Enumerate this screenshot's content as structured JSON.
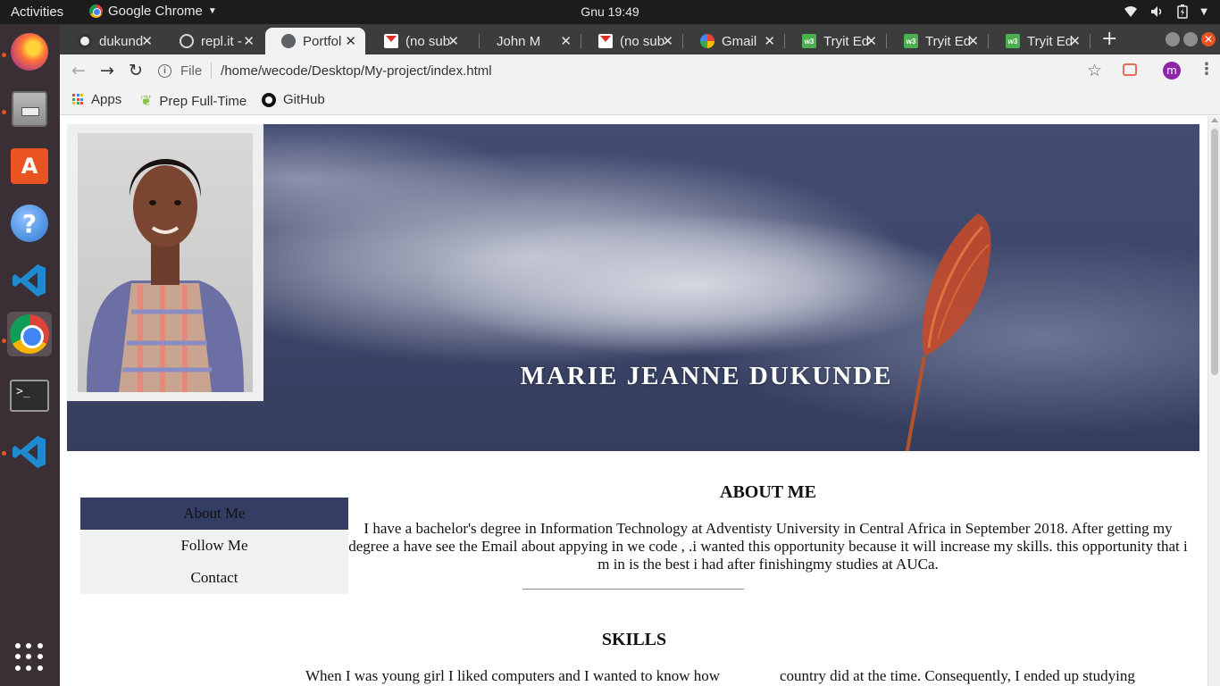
{
  "topbar": {
    "activities": "Activities",
    "app_name": "Google Chrome",
    "clock": "Gnu 19:49"
  },
  "dock": {
    "apps": [
      "firefox",
      "files",
      "ubuntu-software",
      "help",
      "vscode",
      "chrome",
      "terminal",
      "vscode"
    ]
  },
  "browser": {
    "tabs": [
      {
        "title": "dukund",
        "icon": "github-icon"
      },
      {
        "title": "repl.it -",
        "icon": "repl-icon"
      },
      {
        "title": "Portfol",
        "icon": "globe-icon",
        "active": true
      },
      {
        "title": "(no sub",
        "icon": "gmail-icon"
      },
      {
        "title": "John M",
        "icon": ""
      },
      {
        "title": "(no sub",
        "icon": "gmail-icon"
      },
      {
        "title": "Gmail",
        "icon": "google-icon"
      },
      {
        "title": "Tryit Ed",
        "icon": "w3schools-icon"
      },
      {
        "title": "Tryit Ed",
        "icon": "w3schools-icon"
      },
      {
        "title": "Tryit Ed",
        "icon": "w3schools-icon"
      }
    ],
    "address": {
      "scheme": "File",
      "url": "/home/wecode/Desktop/My-project/index.html"
    },
    "profile_initial": "m",
    "bookmarks": [
      "Apps",
      "Prep Full-Time",
      "GitHub"
    ]
  },
  "page": {
    "hero_name": "MARIE JEANNE DUKUNDE",
    "nav": [
      "About Me",
      "Follow Me",
      "Contact"
    ],
    "about_title": "ABOUT ME",
    "about_text": "I have a bachelor's degree in Information Technology at Adventisty University in Central Africa in September 2018. After getting my degree a have see the Email about appying in we code , .i wanted this opportunity because it will increase my skills. this opportunity that i m in is the best i had after finishingmy studies at AUCa.",
    "skills_title": "SKILLS",
    "skills_col1": "When I was young girl I liked computers and I wanted to know how",
    "skills_col2": "country did at the time. Consequently, I ended up studying"
  },
  "colors": {
    "nav_active": "#343d63",
    "hero_bg": "#3e476b",
    "ubuntu_orange": "#e95420"
  }
}
